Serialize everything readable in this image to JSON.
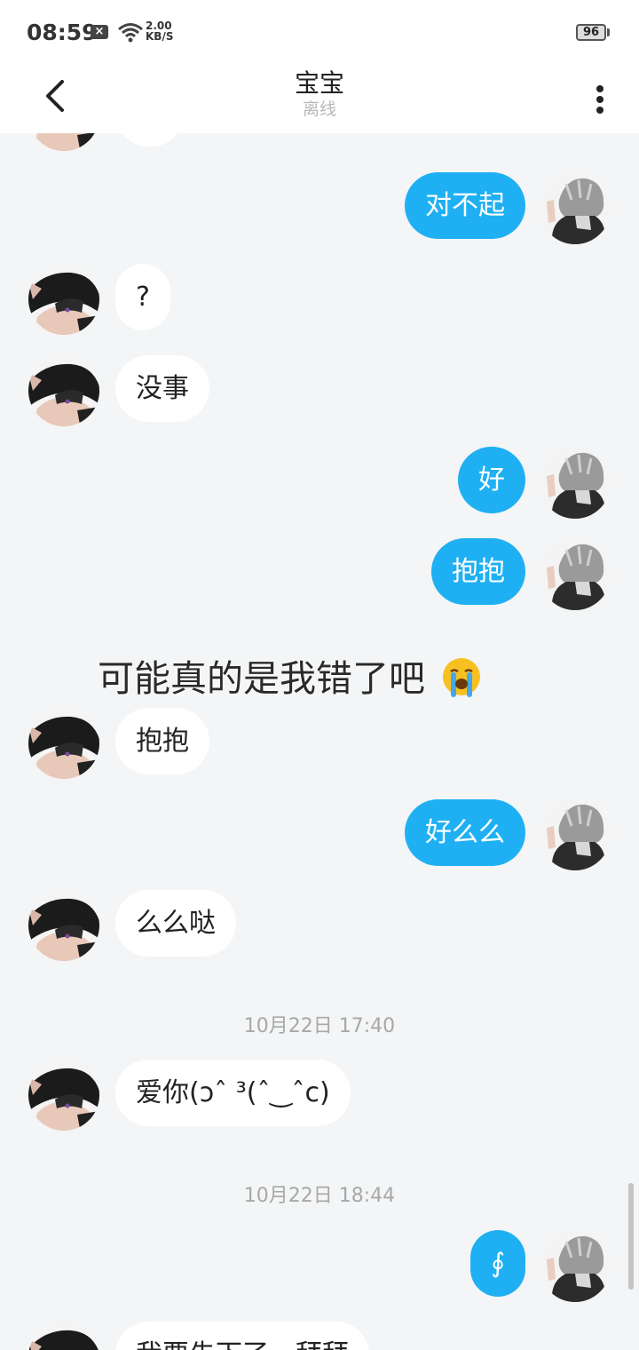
{
  "status_bar": {
    "time": "08:59",
    "net_speed_value": "2.00",
    "net_speed_unit": "KB/S",
    "battery": "96",
    "icons": [
      "x-icon",
      "wifi-icon",
      "battery-icon"
    ]
  },
  "header": {
    "title": "宝宝",
    "status": "离线",
    "back_icon": "chevron-left-icon",
    "more_icon": "more-vertical-icon"
  },
  "messages": [
    {
      "from": "me",
      "text": "对不起"
    },
    {
      "from": "them",
      "text": "?"
    },
    {
      "from": "them",
      "text": "没事"
    },
    {
      "from": "me",
      "text": "好"
    },
    {
      "from": "me",
      "text": "抱抱"
    },
    {
      "from": "them",
      "text": "抱抱"
    },
    {
      "from": "me",
      "text": "好么么"
    },
    {
      "from": "them",
      "text": "么么哒"
    },
    {
      "from": "them",
      "text": "爱你(ↄˆ ³(ˆ‿ˆc)"
    },
    {
      "from": "me",
      "text": "∮"
    },
    {
      "from": "them",
      "text": "我要先下了，拜拜"
    }
  ],
  "timestamps": [
    "10月22日 17:40",
    "10月22日 18:44"
  ],
  "overlay_caption": {
    "text": "可能真的是我错了吧",
    "emoji": "crying-face-icon"
  },
  "colors": {
    "outgoing_bubble": "#1fb0f3",
    "incoming_bubble": "#ffffff",
    "background": "#f3f5f6"
  }
}
